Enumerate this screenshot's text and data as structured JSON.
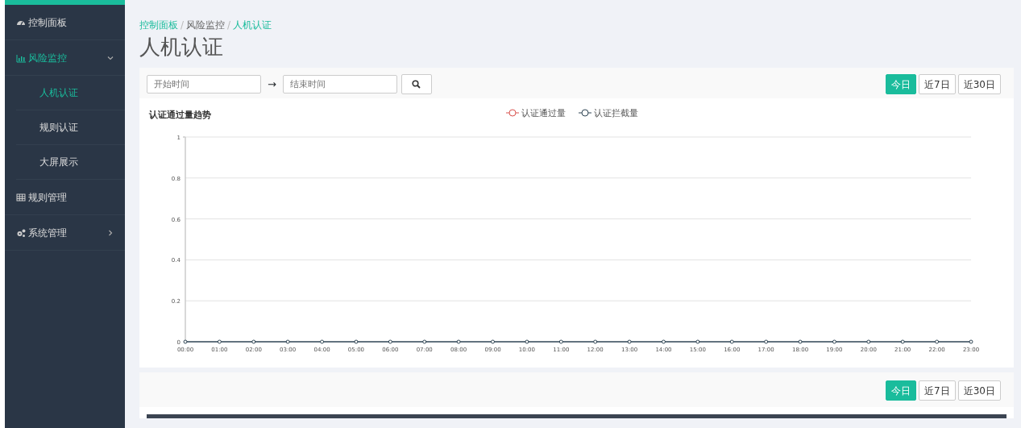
{
  "sidebar": {
    "items": [
      {
        "label": "控制面板",
        "selected": false
      },
      {
        "label": "风险监控",
        "selected": true,
        "expanded": true,
        "children": [
          {
            "label": "人机认证",
            "selected": true
          },
          {
            "label": "规则认证",
            "selected": false
          },
          {
            "label": "大屏展示",
            "selected": false
          }
        ]
      },
      {
        "label": "规则管理",
        "selected": false
      },
      {
        "label": "系统管理",
        "selected": false,
        "expanded": false,
        "has_children": true
      }
    ]
  },
  "breadcrumb": [
    {
      "label": "控制面板"
    },
    {
      "separator": "/",
      "label": "风险监控"
    },
    {
      "separator": "/",
      "label": "人机认证"
    }
  ],
  "page_title": "人机认证",
  "filter": {
    "start": {
      "placeholder": "开始时间"
    },
    "arrow": "→",
    "end": {
      "placeholder": "结束时间"
    }
  },
  "range_buttons": [
    {
      "label": "今日",
      "selected": true
    },
    {
      "label": "近7日",
      "selected": false
    },
    {
      "label": "近30日",
      "selected": false
    }
  ],
  "chart_card": {
    "chart_data": {
      "type": "line",
      "title": "认证通过量趋势",
      "categories": [
        "00:00",
        "01:00",
        "02:00",
        "03:00",
        "04:00",
        "05:00",
        "06:00",
        "07:00",
        "08:00",
        "09:00",
        "10:00",
        "11:00",
        "12:00",
        "13:00",
        "14:00",
        "15:00",
        "16:00",
        "17:00",
        "18:00",
        "19:00",
        "20:00",
        "21:00",
        "22:00",
        "23:00"
      ],
      "ylim": [
        0,
        1
      ],
      "grid": true,
      "legend": true,
      "yticks": [
        {
          "value": 0,
          "label": "0"
        },
        {
          "value": 0.2,
          "label": "0.2"
        },
        {
          "value": 0.4,
          "label": "0.4"
        },
        {
          "value": 0.6,
          "label": "0.6"
        },
        {
          "value": 0.8,
          "label": "0.8"
        },
        {
          "value": 1,
          "label": "1"
        }
      ],
      "series": [
        {
          "name": "认证通过量",
          "color": "#d9534f",
          "marker": "circle",
          "values": [
            null,
            null,
            null,
            null,
            null,
            null,
            null,
            null,
            null,
            null,
            null,
            null,
            null,
            null,
            null,
            null,
            null,
            null,
            null,
            null,
            null,
            null,
            null,
            null
          ]
        },
        {
          "name": "认证拦截量",
          "color": "#2f4554",
          "marker": "circle",
          "values": [
            0,
            0,
            0,
            0,
            0,
            0,
            0,
            0,
            0,
            0,
            0,
            0,
            0,
            0,
            0,
            0,
            0,
            0,
            0,
            0,
            0,
            0,
            0,
            0
          ]
        }
      ]
    }
  },
  "table_card": {
    "range_buttons": [
      {
        "label": "今日",
        "selected": true
      },
      {
        "label": "近7日",
        "selected": false
      },
      {
        "label": "近30日",
        "selected": false
      }
    ]
  }
}
